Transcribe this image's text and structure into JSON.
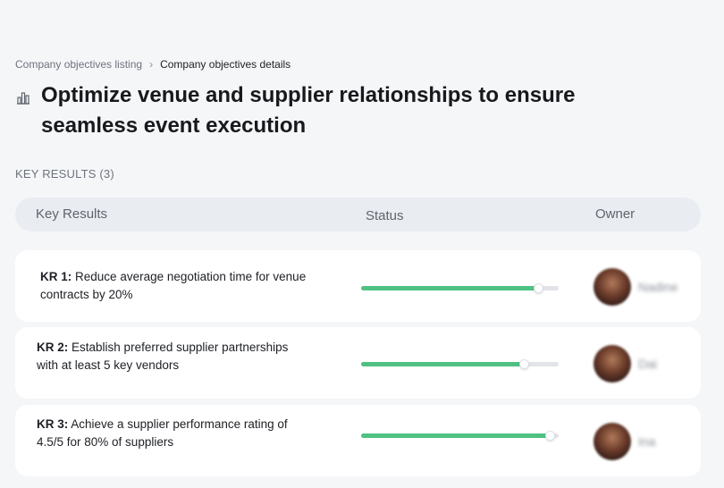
{
  "breadcrumb": {
    "parent": "Company objectives listing",
    "current": "Company objectives details"
  },
  "objective": {
    "icon": "building-chart-icon",
    "title": "Optimize venue and supplier relationships to ensure seamless event execution"
  },
  "key_results_section": {
    "label": "KEY RESULTS (3)"
  },
  "table": {
    "headers": {
      "key_results": "Key Results",
      "status": "Status",
      "owner": "Owner"
    },
    "rows": [
      {
        "code": "KR 1:",
        "text": "Reduce average negotiation time for venue contracts by 20%",
        "progress": 0.9,
        "owner": "Nadine"
      },
      {
        "code": "KR 2:",
        "text": "Establish preferred supplier partnerships with at least 5 key vendors",
        "progress": 0.83,
        "owner": "Dai"
      },
      {
        "code": "KR 3:",
        "text": "Achieve a supplier performance rating of 4.5/5 for 80% of suppliers",
        "progress": 0.96,
        "owner": "Ina"
      }
    ]
  },
  "colors": {
    "progress": "#4fc182",
    "header_bg": "#e9ecf1",
    "page_bg": "#f5f6f8"
  }
}
